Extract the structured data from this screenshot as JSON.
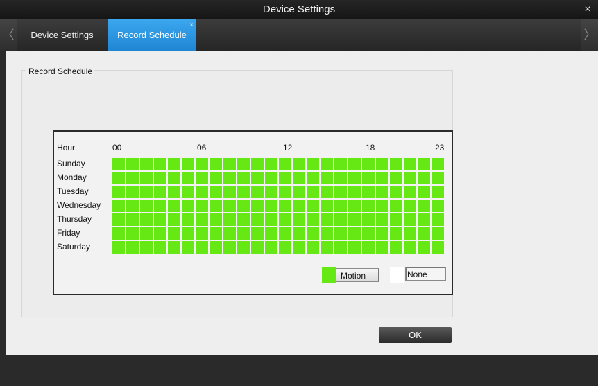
{
  "window": {
    "title": "Device Settings",
    "close_glyph": "×"
  },
  "tabs": {
    "left_arrow": "〈",
    "right_arrow": "〉",
    "items": [
      {
        "label": "Device Settings",
        "active": false
      },
      {
        "label": "Record Schedule",
        "active": true,
        "close_glyph": "×"
      }
    ]
  },
  "group": {
    "title": "Record Schedule"
  },
  "schedule": {
    "corner_label": "Hour",
    "hour_labels": [
      "00",
      "06",
      "12",
      "18",
      "23"
    ],
    "days": [
      "Sunday",
      "Monday",
      "Tuesday",
      "Wednesday",
      "Thursday",
      "Friday",
      "Saturday"
    ],
    "hours_per_day": 24,
    "mode_all_cells": "Motion",
    "colors": {
      "motion": "#66e814",
      "none": "#ffffff"
    }
  },
  "legend": {
    "motion_label": "Motion",
    "none_label": "None"
  },
  "ok_label": "OK"
}
